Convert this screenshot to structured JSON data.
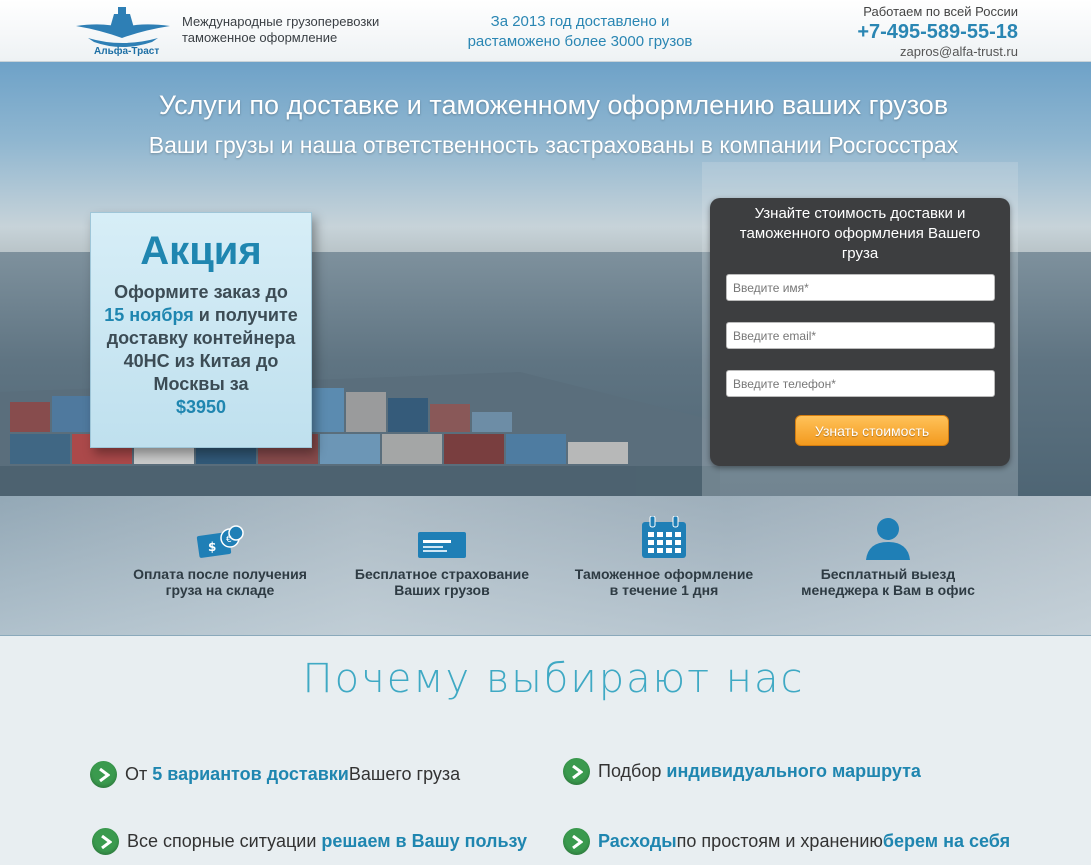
{
  "header": {
    "logo_text": "Альфа-Траст",
    "tagline_1": "Международные грузоперевозки",
    "tagline_2": "таможенное оформление",
    "delivered_1": "За 2013 год доставлено и",
    "delivered_2": "растаможено более 3000 грузов",
    "work_area": "Работаем  по всей России",
    "phone": "+7-495-589-55-18",
    "email": "zapros@alfa-trust.ru"
  },
  "hero": {
    "title": "Услуги по доставке и таможенному оформлению ваших грузов",
    "subtitle": "Ваши грузы и наша ответственность застрахованы в компании Росгосстрах"
  },
  "promo": {
    "title": "Акция",
    "text_1": "Оформите заказ до",
    "date": "15 ноября",
    "text_2": "и получите доставку контейнера 40HC из Китая до Москвы за",
    "price": "$3950"
  },
  "form": {
    "title": "Узнайте стоимость доставки и таможенного оформления Вашего груза",
    "name_placeholder": "Введите имя*",
    "email_placeholder": "Введите email*",
    "phone_placeholder": "Введите телефон*",
    "submit_label": "Узнать стоимость"
  },
  "features": [
    {
      "icon": "money-icon",
      "label_1": "Оплата после получения",
      "label_2": "груза на складе"
    },
    {
      "icon": "card-icon",
      "label_1": "Бесплатное страхование",
      "label_2": "Ваших грузов"
    },
    {
      "icon": "calendar-icon",
      "label_1": "Таможенное оформление",
      "label_2": "в течение 1 дня"
    },
    {
      "icon": "user-icon",
      "label_1": "Бесплатный выезд",
      "label_2": "менеджера к Вам в офис"
    }
  ],
  "why": {
    "title": "Почему выбирают нас",
    "items": [
      {
        "pre": "От ",
        "bold": "5 вариантов доставки",
        "post": " Вашего груза"
      },
      {
        "pre": "Подбор ",
        "bold": "индивидуального маршрута",
        "post": ""
      },
      {
        "pre": "Все спорные ситуации ",
        "bold": "решаем в Вашу пользу",
        "post": ""
      },
      {
        "pre": "",
        "bold": "Расходы",
        "post": " по простоям и хранению ",
        "bold2": "берем на себя"
      }
    ]
  },
  "colors": {
    "accent": "#2a86b3",
    "button": "#f39a1e",
    "check": "#3a9a4e"
  }
}
